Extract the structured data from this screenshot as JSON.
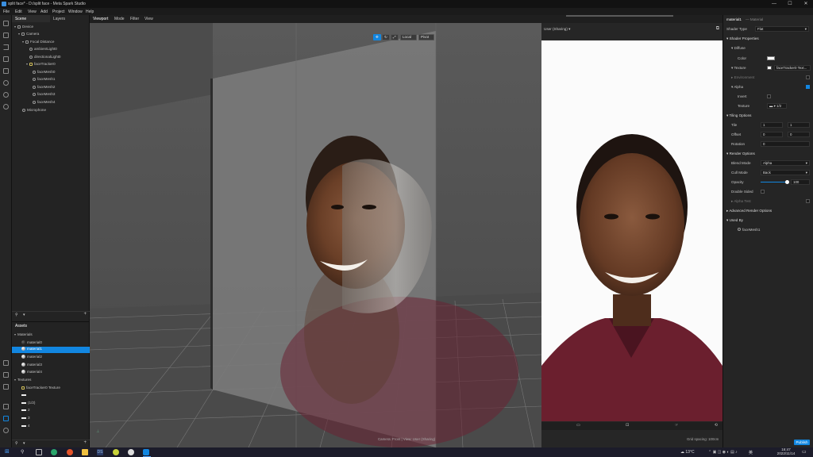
{
  "window": {
    "title": "split face* - D:/split face - Meta Spark Studio",
    "controls": [
      "—",
      "☐",
      "✕"
    ]
  },
  "menu": [
    "File",
    "Edit",
    "View",
    "Add",
    "Project",
    "Window",
    "Help"
  ],
  "scene": {
    "tabs": [
      "Scene",
      "Layers"
    ],
    "tree": [
      {
        "label": "Device",
        "depth": 0
      },
      {
        "label": "Camera",
        "depth": 1
      },
      {
        "label": "Focal Distance",
        "depth": 2
      },
      {
        "label": "ambientLight0",
        "depth": 3
      },
      {
        "label": "directionalLight0",
        "depth": 3
      },
      {
        "label": "faceTracker0",
        "depth": 3
      },
      {
        "label": "faceMesh0",
        "depth": 4
      },
      {
        "label": "faceMesh1",
        "depth": 4
      },
      {
        "label": "faceMesh2",
        "depth": 4
      },
      {
        "label": "faceMesh3",
        "depth": 4
      },
      {
        "label": "faceMesh4",
        "depth": 4
      },
      {
        "label": "Microphone",
        "depth": 1
      }
    ]
  },
  "assets": {
    "title": "Assets",
    "materials_label": "Materials",
    "materials": [
      "material0",
      "material1",
      "material2",
      "material3",
      "material4"
    ],
    "selected_material": "material1",
    "textures_label": "Textures",
    "textures": [
      "faceTracker0 Texture",
      "",
      "(1/2)",
      "2",
      "3",
      "4"
    ]
  },
  "viewport": {
    "tabs": [
      "Viewport",
      "Mode",
      "Filter",
      "View"
    ],
    "gizmo": {
      "local": "Local",
      "pivot": "Pivot"
    },
    "status": "Camera: Front | View: User (Sharing)",
    "grid_spacing": "Grid spacing: 100cm"
  },
  "simulator": {
    "device": "User (Sharing)"
  },
  "properties": {
    "object_name": "material1",
    "object_type": "Material",
    "shader_type_label": "Shader Type",
    "shader_type": "Flat",
    "shader_properties": "Shader Properties",
    "diffuse": "Diffuse",
    "color_label": "Color",
    "texture_label": "Texture",
    "texture_value": "faceTracker0 Text...",
    "environment": "Environment",
    "alpha": "Alpha",
    "invert": "Invert",
    "alpha_texture_label": "Texture",
    "alpha_texture_value": "1/2",
    "tiling_options": "Tiling Options",
    "tile_label": "Tile",
    "tile": [
      "1",
      "1"
    ],
    "offset_label": "Offset",
    "offset": [
      "0",
      "0"
    ],
    "rotation_label": "Rotation",
    "rotation": "0",
    "render_options": "Render Options",
    "blend_mode_label": "Blend Mode",
    "blend_mode": "Alpha",
    "cull_mode_label": "Cull Mode",
    "cull_mode": "Back",
    "opacity_label": "Opacity",
    "opacity": "100",
    "double_sided": "Double Sided",
    "alpha_test": "Alpha Test",
    "advanced": "Advanced Render Options",
    "used_by": "Used By",
    "used_by_item": "faceMesh1",
    "publish": "Publish"
  },
  "taskbar": {
    "weather": "13°C",
    "time": "16:47",
    "date": "2022/11/14",
    "lang": "英"
  },
  "colors": {
    "accent": "#1286e0",
    "panel": "#232323",
    "taskbar": "#1c1c2a"
  }
}
